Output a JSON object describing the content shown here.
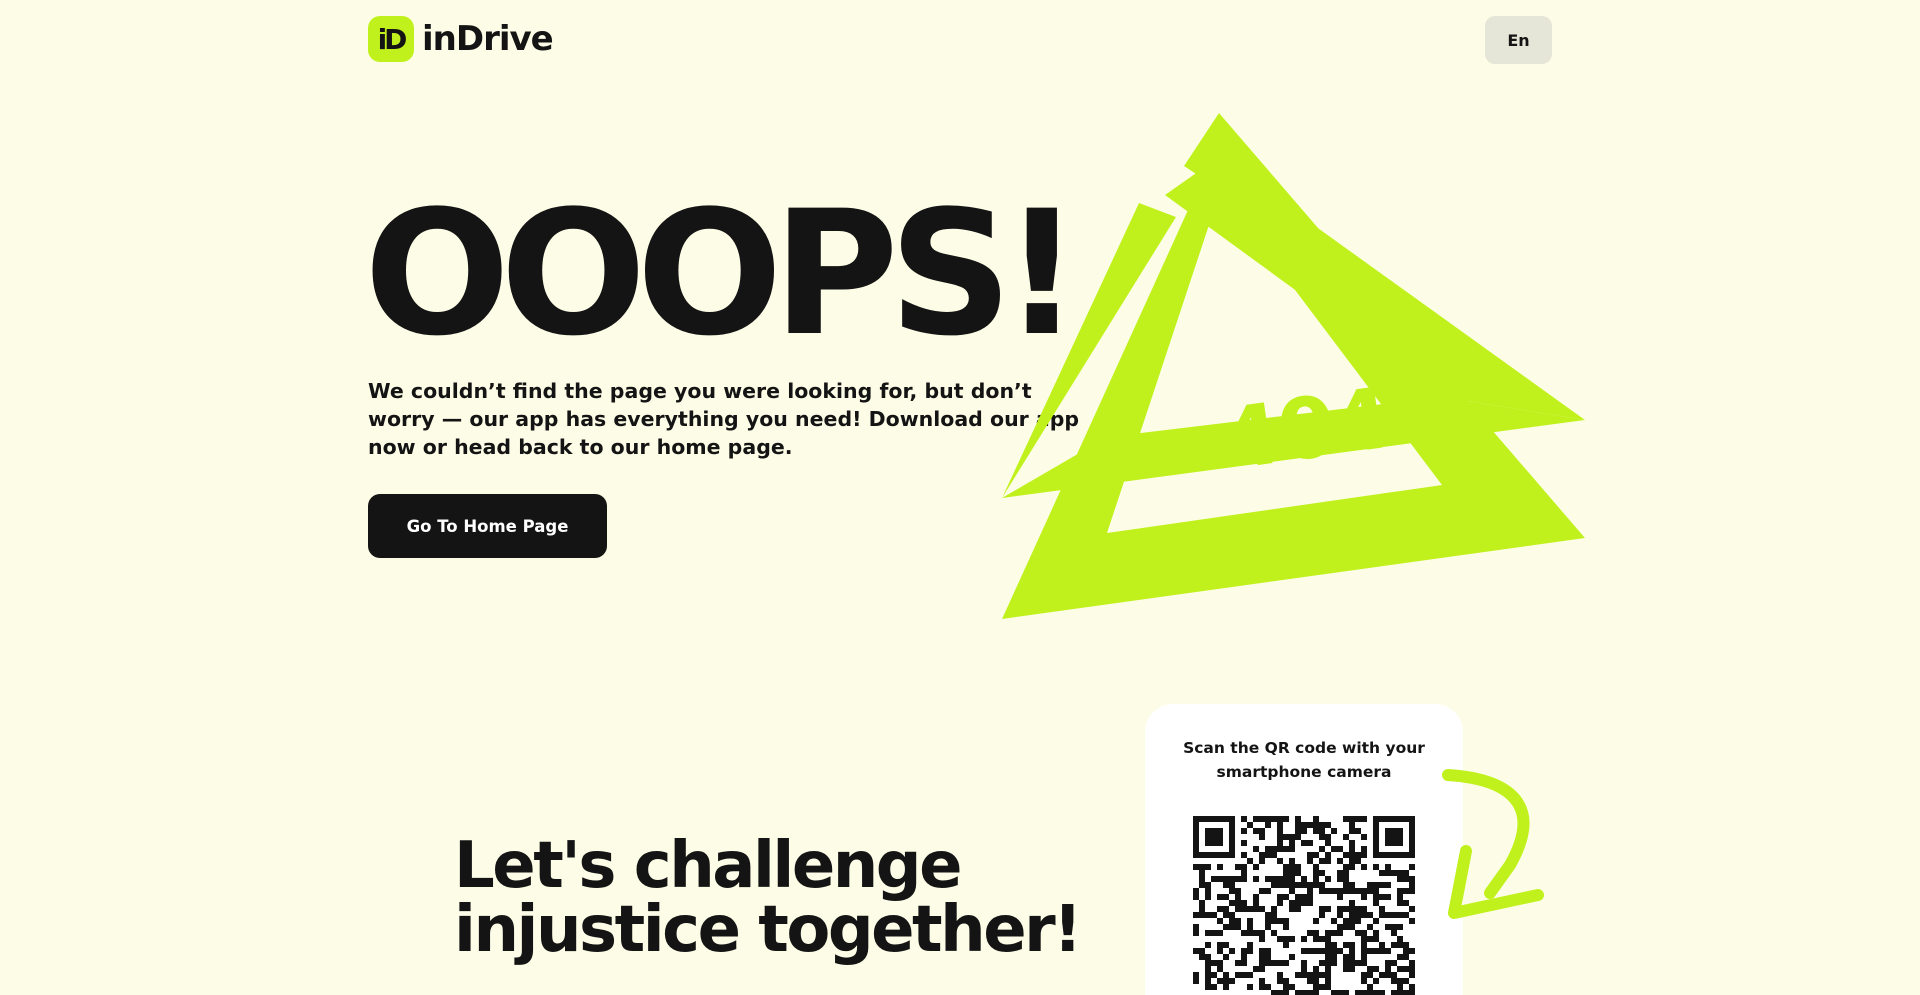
{
  "header": {
    "logo_mark": "iD",
    "logo_text": "inDrive",
    "language_label": "En"
  },
  "hero": {
    "title": "OOOPS!",
    "message": "We couldn’t find the page you were looking for, but don’t worry — our app has everything you need! Download our app now or head back to our home page.",
    "home_button_label": "Go To Home Page",
    "error_code": "404"
  },
  "bottom": {
    "challenge_line1": "Let's challenge",
    "challenge_line2": "injustice together!",
    "qr_caption": "Scan the QR code with your smartphone camera"
  },
  "colors": {
    "background": "#fdfde7",
    "accent": "#c1f11d",
    "text": "#141414",
    "button_bg": "#141414",
    "card_bg": "#ffffff"
  }
}
